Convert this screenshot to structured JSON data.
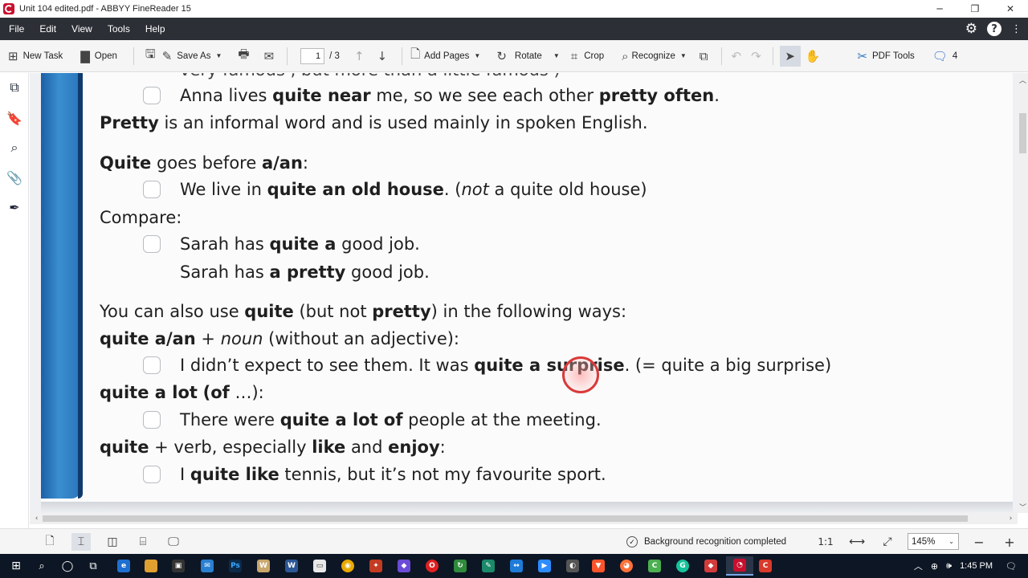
{
  "window": {
    "title": "Unit 104 edited.pdf - ABBYY FineReader 15",
    "minimize": "─",
    "restore": "❐",
    "close": "✕"
  },
  "menu": [
    "File",
    "Edit",
    "View",
    "Tools",
    "Help"
  ],
  "toolbar": {
    "new_task": "New Task",
    "open": "Open",
    "save_as": "Save As",
    "page_current": "1",
    "page_total": "/ 3",
    "add_pages": "Add Pages",
    "rotate": "Rotate",
    "crop": "Crop",
    "recognize": "Recognize",
    "pdf_tools": "PDF Tools",
    "comments_count": "4"
  },
  "document": {
    "lines": [
      {
        "pre": "very famous , but more than a little famous )"
      },
      {
        "s1": "Anna lives ",
        "b1": "quite near",
        "s2": " me, so we see each other ",
        "b2": "pretty often",
        "s3": "."
      },
      {
        "b1": "Pretty",
        "s1": " is an informal word and is used mainly in spoken English."
      },
      {
        "b1": "Quite",
        "s1": " goes before ",
        "b2": "a/an",
        "s2": ":"
      },
      {
        "s1": "We live in ",
        "b1": "quite an old house",
        "s2": ".   (",
        "i1": "not",
        "s3": " a quite old house)"
      },
      {
        "s1": "Compare:"
      },
      {
        "s1": "Sarah has ",
        "b1": "quite a",
        "s2": " good job."
      },
      {
        "s1": "Sarah has ",
        "b1": "a pretty",
        "s2": " good job."
      },
      {
        "s1": "You can also use ",
        "b1": "quite",
        "s2": " (but not ",
        "b2": "pretty",
        "s3": ") in the following ways:"
      },
      {
        "b1": "quite a/an",
        "s1": " + ",
        "i1": "noun",
        "s2": " (without an adjective):"
      },
      {
        "s1": "I didn’t expect to see them.  It was ",
        "b1": "quite a surprise",
        "s2": ".   (= quite a big surprise)"
      },
      {
        "b1": "quite a lot",
        "s1": " ",
        "b2": "(of",
        "s2": " …):"
      },
      {
        "s1": "There were ",
        "b1": "quite a lot of",
        "s2": " people at the meeting."
      },
      {
        "b1": "quite",
        "s1": " + verb, especially ",
        "b2": "like",
        "s2": " and ",
        "b3": "enjoy",
        "s3": ":"
      },
      {
        "s1": "I ",
        "b1": "quite like",
        "s2": " tennis, but it’s not my favourite sport."
      }
    ]
  },
  "statusbar": {
    "status_text": "Background recognition completed",
    "ratio": "1:1",
    "zoom": "145%"
  },
  "taskbar": {
    "time": "1:45 PM"
  },
  "colors": {
    "menubar": "#2c2f36",
    "accent_blue": "#1c5fa6",
    "cursor_red": "#d93a3a"
  }
}
